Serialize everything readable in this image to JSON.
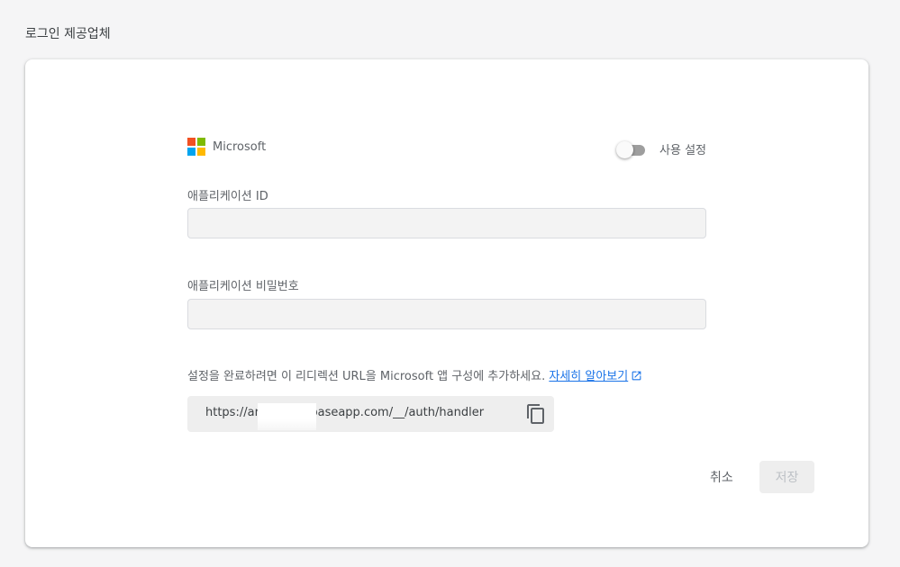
{
  "section": {
    "title": "로그인 제공업체"
  },
  "provider": {
    "name": "Microsoft",
    "logo_colors": [
      "#f25022",
      "#7fba00",
      "#00a4ef",
      "#ffb900"
    ],
    "enable_label": "사용 설정",
    "enabled": false
  },
  "fields": {
    "app_id": {
      "label": "애플리케이션 ID",
      "value": ""
    },
    "app_secret": {
      "label": "애플리케이션 비밀번호",
      "value": ""
    }
  },
  "instruction": {
    "text": "설정을 완료하려면 이 리디렉션 URL을 Microsoft 앱 구성에 추가하세요.",
    "link_label": "자세히 알아보기",
    "link_icon": "open-in-new-icon"
  },
  "redirect": {
    "url": "https://aris      92.firebaseapp.com/__/auth/handler",
    "copy_icon": "copy-icon"
  },
  "actions": {
    "cancel": "취소",
    "save": "저장"
  },
  "colors": {
    "link": "#1a73e8",
    "toggle_off": "#9e9e9e"
  }
}
